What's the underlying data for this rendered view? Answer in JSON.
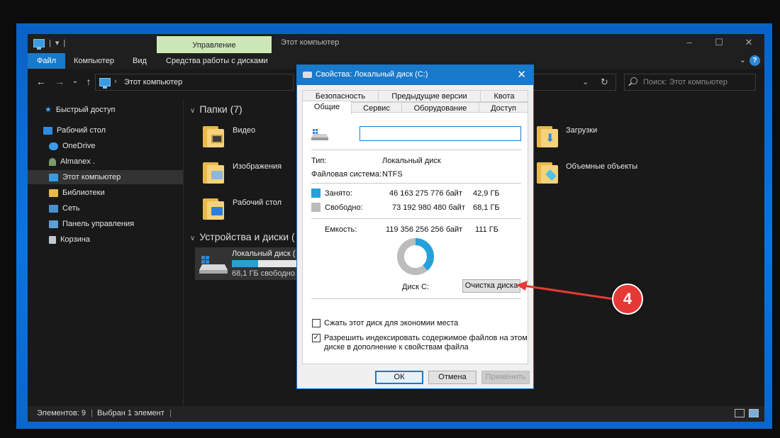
{
  "titlebar": {
    "context_tab": "Управление",
    "window_title": "Этот компьютер"
  },
  "ribbon": {
    "tabs": [
      "Файл",
      "Компьютер",
      "Вид",
      "Средства работы с дисками"
    ]
  },
  "address": {
    "path": "Этот компьютер",
    "search_placeholder": "Поиск: Этот компьютер"
  },
  "sidebar": {
    "items": [
      {
        "label": "Быстрый доступ",
        "icon": "star-icon"
      },
      {
        "label": "Рабочий стол",
        "icon": "desktop-icon"
      },
      {
        "label": "OneDrive",
        "icon": "cloud-icon"
      },
      {
        "label": "Almanex .",
        "icon": "user-icon"
      },
      {
        "label": "Этот компьютер",
        "icon": "computer-icon"
      },
      {
        "label": "Библиотеки",
        "icon": "library-icon"
      },
      {
        "label": "Сеть",
        "icon": "network-icon"
      },
      {
        "label": "Панель управления",
        "icon": "control-panel-icon"
      },
      {
        "label": "Корзина",
        "icon": "recycle-bin-icon"
      }
    ]
  },
  "main": {
    "folders_header": "Папки (7)",
    "folders": [
      "Видео",
      "Изображения",
      "Рабочий стол",
      "Загрузки",
      "Объемные объекты"
    ],
    "devices_header": "Устройства и диски (",
    "drive": {
      "name": "Локальный диск (",
      "free": "68,1 ГБ свободно",
      "used_fraction": 0.387
    }
  },
  "status": {
    "items_count": "Элементов: 9",
    "selected": "Выбран 1 элемент"
  },
  "dialog": {
    "title": "Свойства: Локальный диск (C:)",
    "tabs_row1": [
      "Безопасность",
      "Предыдущие версии",
      "Квота"
    ],
    "tabs_row2": [
      "Общие",
      "Сервис",
      "Оборудование",
      "Доступ"
    ],
    "name_value": "",
    "type_label": "Тип:",
    "type_value": "Локальный диск",
    "fs_label": "Файловая система:",
    "fs_value": "NTFS",
    "used_label": "Занято:",
    "used_bytes": "46 163 275 776 байт",
    "used_gb": "42,9 ГБ",
    "free_label": "Свободно:",
    "free_bytes": "73 192 980 480 байт",
    "free_gb": "68,1 ГБ",
    "capacity_label": "Емкость:",
    "capacity_bytes": "119 356 256 256 байт",
    "capacity_gb": "111 ГБ",
    "used_fraction": 0.387,
    "drive_label": "Диск C:",
    "cleanup_button": "Очистка диска",
    "compress_checkbox": "Сжать этот диск для экономии места",
    "compress_checked": false,
    "index_checkbox_line1": "Разрешить индексировать содержимое файлов на этом",
    "index_checkbox_line2": "диске в дополнение к свойствам файла",
    "index_checked": true,
    "ok_button": "ОК",
    "cancel_button": "Отмена",
    "apply_button": "Применить",
    "used_color": "#26a0da",
    "free_color": "#bcbcbc"
  },
  "annotation": {
    "step_number": "4",
    "color": "#e53935"
  }
}
